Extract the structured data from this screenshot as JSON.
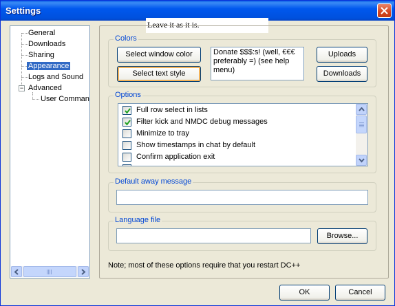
{
  "window": {
    "title": "Settings"
  },
  "tooltip": "Leave it as it is.",
  "tree": {
    "items": [
      {
        "label": "General"
      },
      {
        "label": "Downloads"
      },
      {
        "label": "Sharing"
      },
      {
        "label": "Appearance",
        "selected": true
      },
      {
        "label": "Logs and Sound"
      },
      {
        "label": "Advanced",
        "expander": "⊟"
      },
      {
        "label": "User Commands"
      }
    ]
  },
  "colors": {
    "title": "Colors",
    "select_window_color": "Select window color",
    "select_text_style": "Select text style",
    "preview_text": "Donate $$$:s! (well, €€€ preferably =) (see help menu)",
    "uploads": "Uploads",
    "downloads": "Downloads"
  },
  "options": {
    "title": "Options",
    "items": [
      {
        "label": "Full row select in lists",
        "checked": true
      },
      {
        "label": "Filter kick and NMDC debug messages",
        "checked": true
      },
      {
        "label": "Minimize to tray",
        "checked": false
      },
      {
        "label": "Show timestamps in chat by default",
        "checked": false
      },
      {
        "label": "Confirm application exit",
        "checked": false
      }
    ]
  },
  "away": {
    "title": "Default away message",
    "value": ""
  },
  "language": {
    "title": "Language file",
    "value": "",
    "browse": "Browse..."
  },
  "note": "Note; most of these options require that you restart DC++",
  "footer": {
    "ok": "OK",
    "cancel": "Cancel"
  },
  "accent": {
    "titlebar": "#0054e3",
    "selection": "#316ac5",
    "group_title": "#0046d5"
  }
}
